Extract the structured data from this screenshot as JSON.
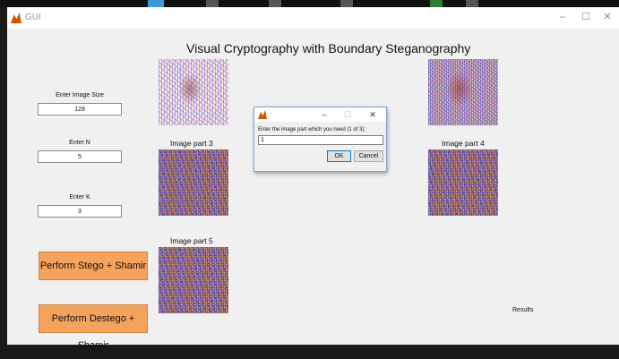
{
  "window": {
    "title": "GUI",
    "controls": {
      "minimize": "–",
      "maximize": "☐",
      "close": "✕"
    }
  },
  "heading": "Visual Cryptography with Boundary Steganography",
  "inputs": {
    "image_size": {
      "label": "Enter Image Size",
      "value": "128"
    },
    "n": {
      "label": "Enter N",
      "value": "5"
    },
    "k": {
      "label": "Enter K",
      "value": "3"
    }
  },
  "buttons": {
    "stego": "Perform Stego + Shamir",
    "destego": "Perform Destego + Shamir"
  },
  "images": {
    "part3_label": "Image part 3",
    "part4_label": "Image part 4",
    "part5_label": "Image part 5"
  },
  "dialog": {
    "controls": {
      "minimize": "–",
      "maximize": "☐",
      "close": "✕"
    },
    "prompt": "Enter the image part which you need (1 of 3):",
    "value": "1",
    "ok": "OK",
    "cancel": "Cancel"
  },
  "results_label": "Results",
  "colors": {
    "button_orange": "#f5a35c",
    "dialog_border": "#7aa7d8"
  }
}
